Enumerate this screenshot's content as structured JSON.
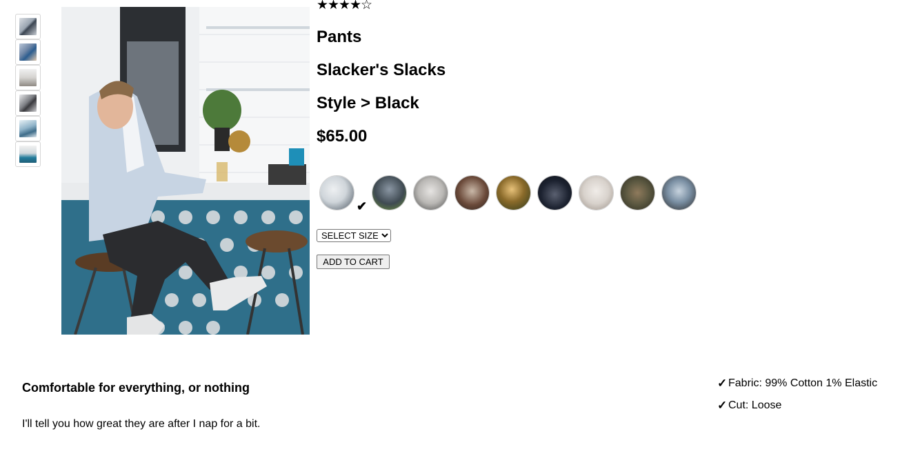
{
  "product": {
    "rating_stars": [
      "★",
      "★",
      "★",
      "★",
      "☆"
    ],
    "rating_value": 4.25,
    "category": "Pants",
    "name": "Slacker's Slacks",
    "style_line": "Style > Black",
    "price": "$65.00"
  },
  "thumbnails": [
    {
      "label": "thumbnail 1"
    },
    {
      "label": "thumbnail 2"
    },
    {
      "label": "thumbnail 3"
    },
    {
      "label": "thumbnail 4"
    },
    {
      "label": "thumbnail 5"
    },
    {
      "label": "thumbnail 6"
    }
  ],
  "styles": {
    "selected_index": 0,
    "check_glyph": "✔",
    "colors": [
      "#cfd5da",
      "#3f4a52",
      "#b9b7b4",
      "#6b4a3a",
      "#8a6a2a",
      "#1c2230",
      "#d8d2cc",
      "#5a5740",
      "#7a8fa3"
    ]
  },
  "size_select": {
    "value": "SELECT SIZE",
    "options": [
      "SELECT SIZE"
    ]
  },
  "cart_button": {
    "label": "ADD TO CART"
  },
  "description": {
    "slogan": "Comfortable for everything, or nothing",
    "text": "I'll tell you how great they are after I nap for a bit."
  },
  "features": [
    {
      "icon": "check-icon",
      "glyph": "✓",
      "text": "Fabric: 99% Cotton 1% Elastic"
    },
    {
      "icon": "check-icon",
      "glyph": "✓",
      "text": "Cut: Loose"
    }
  ]
}
